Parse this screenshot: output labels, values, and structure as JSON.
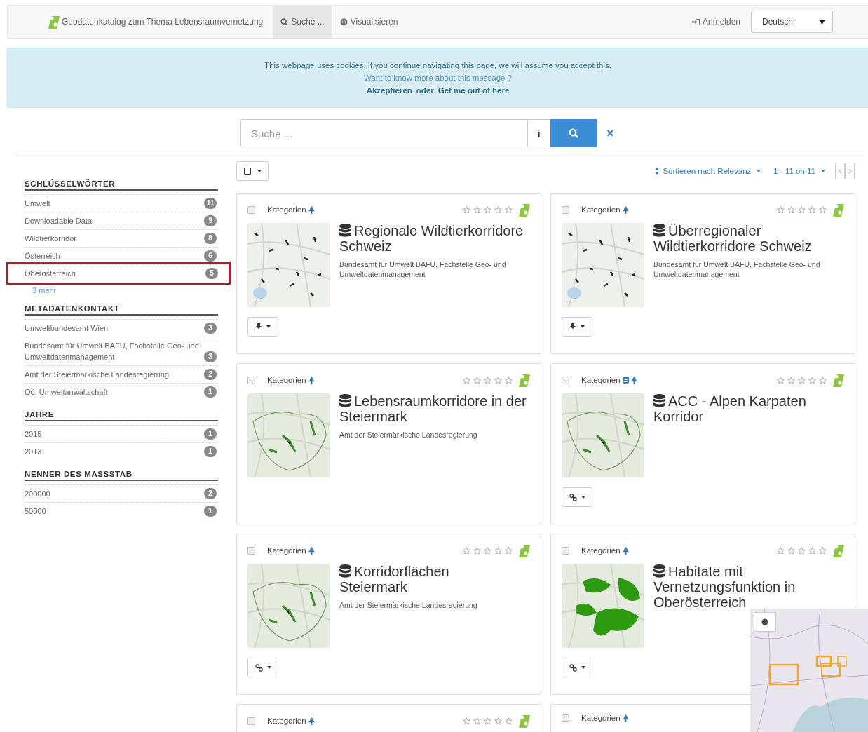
{
  "navbar": {
    "brand": "Geodatenkatalog zum Thema Lebensraumvernetzung",
    "links": [
      {
        "label": "Suche ...",
        "kind": "search",
        "selected": true
      },
      {
        "label": "Visualisieren",
        "kind": "globe",
        "selected": false
      }
    ],
    "login": "Anmelden",
    "language": "Deutsch"
  },
  "cookie_banner": {
    "message": "This webpage uses cookies. If you continue navigating this page, we will assume you accept this.",
    "more_link": "Want to know more about this message ?",
    "accept": "Akzeptieren",
    "or": "oder",
    "leave": "Get me out of here"
  },
  "search": {
    "placeholder": "Suche ...",
    "info": "i",
    "clear": "×"
  },
  "facets": [
    {
      "title": "SCHLÜSSELWÖRTER",
      "items": [
        {
          "label": "Umwelt",
          "count": "11",
          "highlighted": false
        },
        {
          "label": "Downloadable Data",
          "count": "9",
          "highlighted": false
        },
        {
          "label": "Wildtierkorridor",
          "count": "8",
          "highlighted": false
        },
        {
          "label": "Österreich",
          "count": "6",
          "highlighted": false
        },
        {
          "label": "Oberösterreich",
          "count": "5",
          "highlighted": true
        }
      ],
      "more": "3 mehr"
    },
    {
      "title": "METADATENKONTAKT",
      "items": [
        {
          "label": "Umweltbundesamt Wien",
          "count": "3",
          "highlighted": false
        },
        {
          "label": "Bundesamt für Umwelt BAFU, Fachstelle Geo- und Umweltdatenmanagement",
          "count": "3",
          "highlighted": false
        },
        {
          "label": "Amt der Steiermärkische Landesregierung",
          "count": "2",
          "highlighted": false
        },
        {
          "label": "Oö. Umweltanwaltschaft",
          "count": "1",
          "highlighted": false
        }
      ]
    },
    {
      "title": "JAHRE",
      "items": [
        {
          "label": "2015",
          "count": "1",
          "highlighted": false
        },
        {
          "label": "2013",
          "count": "1",
          "highlighted": false
        }
      ]
    },
    {
      "title": "NENNER DES MASSSTAB",
      "items": [
        {
          "label": "200000",
          "count": "2",
          "highlighted": false
        },
        {
          "label": "50000",
          "count": "1",
          "highlighted": false
        }
      ]
    }
  ],
  "toolbar": {
    "sort": "Sortieren nach Relevanz",
    "pagination": "1 - 11 on 11"
  },
  "results": [
    {
      "category": "Kategorien",
      "database_category": false,
      "stars": 0,
      "title": "Regionale Wildtierkorridore Schweiz",
      "contact": "Bundesamt für Umwelt BAFU, Fachstelle Geo- und Umweltdatenmanagement",
      "kind": "download",
      "checked": false
    },
    {
      "category": "Kategorien",
      "database_category": false,
      "stars": 0,
      "title": "Überregionaler Wildtierkorridore Schweiz",
      "contact": "Bundesamt für Umwelt BAFU, Fachstelle Geo- und Umweltdatenmanagement",
      "kind": "download",
      "checked": false
    },
    {
      "category": "Kategorien",
      "database_category": false,
      "stars": 0,
      "title": "Lebensraumkorridore in der Steiermark",
      "contact": "Amt der Steiermärkische Landesregierung",
      "kind": "plain",
      "checked": false
    },
    {
      "category": "Kategorien",
      "database_category": true,
      "stars": 0,
      "title": "ACC - Alpen Karpaten Korridor",
      "kind": "link",
      "checked": false
    },
    {
      "category": "Kategorien",
      "database_category": false,
      "stars": 0,
      "title": "Korridorflächen Steiermark",
      "contact": "Amt der Steiermärkische Landesregierung",
      "kind": "link",
      "checked": false
    },
    {
      "category": "Kategorien",
      "database_category": false,
      "stars": 0,
      "title": "Habitate mit Vernetzungsfunktion in Oberösterreich",
      "kind": "link",
      "checked": false
    },
    {
      "category": "Kategorien",
      "database_category": false,
      "stars": 0,
      "kind": "cut",
      "checked": false
    },
    {
      "category": "Kategorien",
      "database_category": false,
      "kind": "cut",
      "checked": false
    }
  ]
}
